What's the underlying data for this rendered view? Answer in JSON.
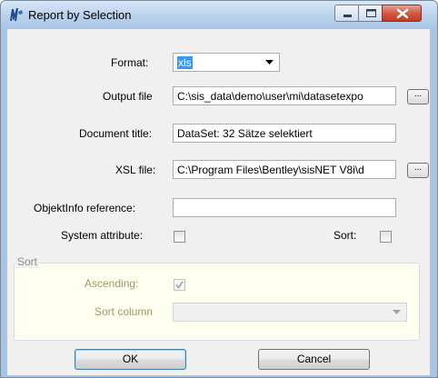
{
  "window": {
    "title": "Report by Selection"
  },
  "form": {
    "format_label": "Format:",
    "format_value": "xls",
    "output_label": "Output file",
    "output_value": "C:\\sis_data\\demo\\user\\mi\\datasetexpo",
    "doc_title_label": "Document title:",
    "doc_title_value": "DataSet: 32 Sätze selektiert",
    "xsl_label": "XSL file:",
    "xsl_value": "C:\\Program Files\\Bentley\\sisNET V8i\\d",
    "objektinfo_label": "ObjektInfo reference:",
    "objektinfo_value": "",
    "sysattr_label": "System attribute:",
    "sort_label": "Sort:",
    "browse_label": "..."
  },
  "sort_group": {
    "title": "Sort",
    "ascending_label": "Ascending:",
    "ascending_checked": true,
    "sort_column_label": "Sort column",
    "sort_column_value": ""
  },
  "buttons": {
    "ok": "OK",
    "cancel": "Cancel"
  },
  "colors": {
    "title_gradient": "#b9d1ec",
    "close_button": "#c23b22",
    "groupbox_bg": "#ffffef",
    "selection": "#3399ff"
  }
}
